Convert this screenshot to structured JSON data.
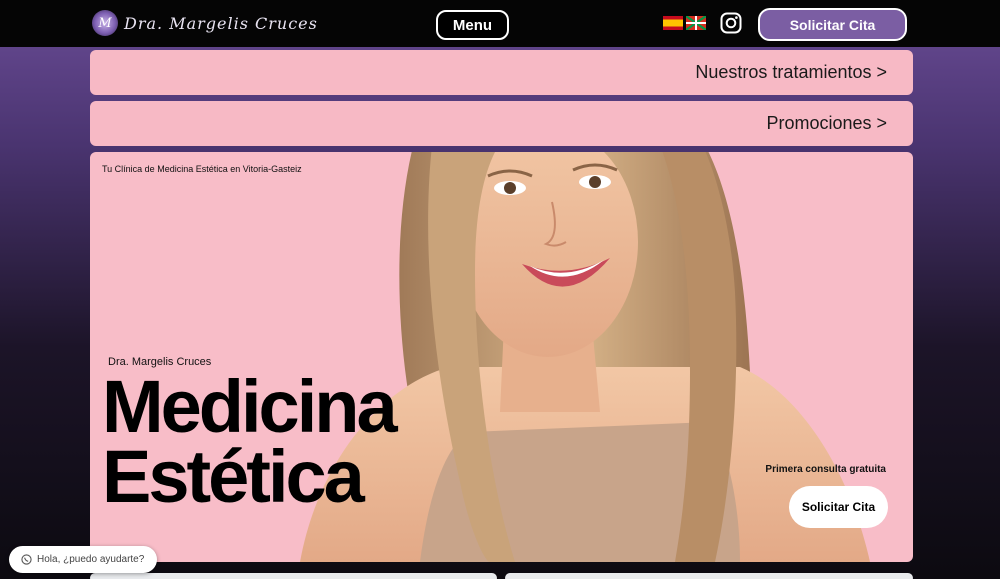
{
  "header": {
    "logo_text": "Dra. Margelis Cruces",
    "logo_mark": "M",
    "menu_label": "Menu",
    "cta_label": "Solicitar Cita",
    "languages": [
      "es-flag-icon",
      "eu-flag-icon"
    ],
    "social": "instagram-icon",
    "accent_color": "#7b5ea3"
  },
  "nav_bars": {
    "treatments_label": "Nuestros tratamientos >",
    "promos_label": "Promociones >"
  },
  "hero": {
    "tagline": "Tu Clínica de Medicina Estética en Vitoria-Gasteiz",
    "doctor_name": "Dra. Margelis Cruces",
    "title_line1": "Medicina",
    "title_line2": "Estética",
    "free_consult": "Primera consulta gratuita",
    "cta_label": "Solicitar Cita",
    "background_color": "#f8bdc8"
  },
  "chat": {
    "label": "Hola, ¿puedo ayudarte?",
    "icon": "whatsapp-icon"
  }
}
